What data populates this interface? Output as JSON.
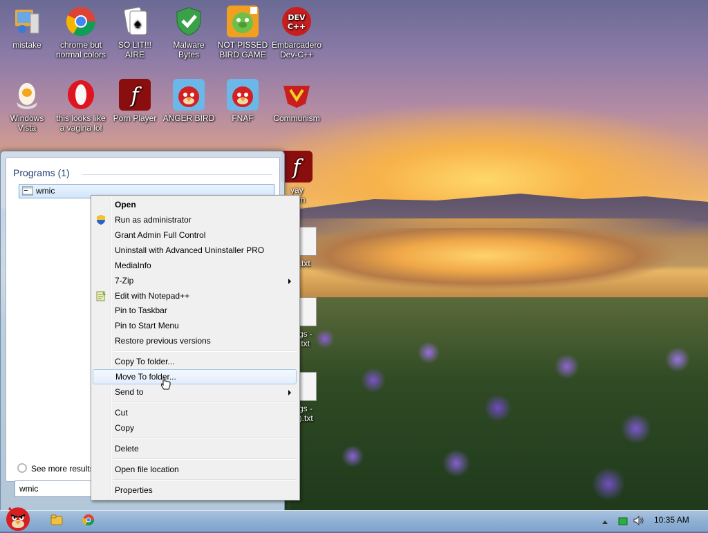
{
  "desktop": {
    "icons": [
      {
        "label": "mistake",
        "icon": "computer-monitor-icon"
      },
      {
        "label": "chrome but normal colors",
        "icon": "chrome-icon"
      },
      {
        "label": "SO LIT!!! AIRE",
        "icon": "solitaire-cards-icon"
      },
      {
        "label": "Malware Bytes",
        "icon": "shield-check-icon"
      },
      {
        "label": "NOT PISSED BIRD GAME",
        "icon": "green-pig-icon"
      },
      {
        "label": "Embarcadero Dev-C++",
        "icon": "devcpp-icon"
      },
      {
        "label": "Windows Vista",
        "icon": "egg-icon"
      },
      {
        "label": "this looks like a vagina lol",
        "icon": "opera-icon"
      },
      {
        "label": "Porn Player",
        "icon": "flash-icon"
      },
      {
        "label": "ANGER BIRD",
        "icon": "angry-bird-icon"
      },
      {
        "label": "FNAF",
        "icon": "angry-bird-icon"
      },
      {
        "label": "Communism",
        "icon": "emblem-icon"
      }
    ],
    "partial_labels": [
      "yay",
      "lism",
      "gs.txt",
      "gs -",
      ".txt",
      "gs -",
      "2).txt"
    ]
  },
  "start_menu": {
    "section_title": "Programs (1)",
    "result": "wmic",
    "see_more": "See more results",
    "search_value": "wmic"
  },
  "context_menu": {
    "items": [
      {
        "label": "Open",
        "bold": true
      },
      {
        "label": "Run as administrator",
        "icon": "uac-shield-icon"
      },
      {
        "label": "Grant Admin Full Control"
      },
      {
        "label": "Uninstall with Advanced Uninstaller PRO"
      },
      {
        "label": "MediaInfo"
      },
      {
        "label": "7-Zip",
        "submenu": true
      },
      {
        "label": "Edit with Notepad++",
        "icon": "notepadpp-icon"
      },
      {
        "label": "Pin to Taskbar"
      },
      {
        "label": "Pin to Start Menu"
      },
      {
        "label": "Restore previous versions"
      },
      {
        "label": "Copy To folder..."
      },
      {
        "label": "Move To folder...",
        "highlighted": true
      },
      {
        "label": "Send to",
        "submenu": true
      },
      {
        "label": "Cut"
      },
      {
        "label": "Copy"
      },
      {
        "label": "Delete"
      },
      {
        "label": "Open file location"
      },
      {
        "label": "Properties"
      }
    ]
  },
  "taskbar": {
    "clock": "10:35 AM"
  }
}
